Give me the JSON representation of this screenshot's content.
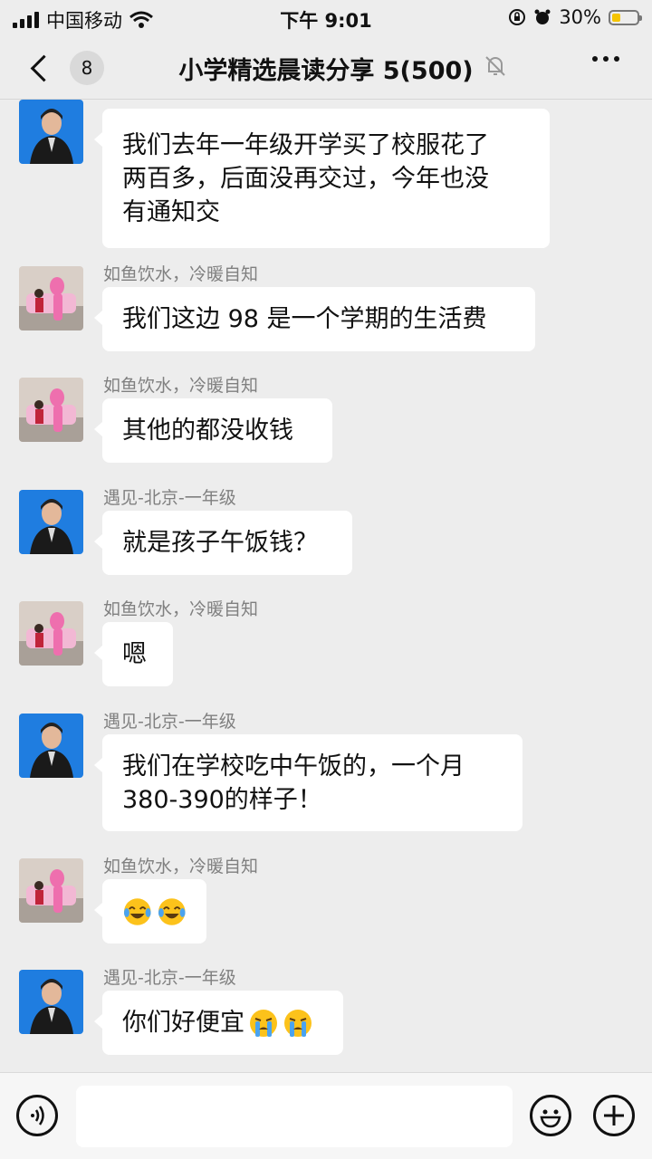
{
  "status_bar": {
    "carrier": "中国移动",
    "time": "下午 9:01",
    "battery": "30%"
  },
  "nav": {
    "back_count": "8",
    "title": "小学精选晨读分享 5(500)"
  },
  "messages": [
    {
      "sender": "遇见-北京-一年级",
      "text": [
        "我们去年一年级开学买了校服花了",
        "两百多，后面没再交过，今年也没",
        "有通知交"
      ],
      "avatar": "woman-avatar"
    },
    {
      "sender": "如鱼饮水，冷暖自知",
      "text": [
        "我们这边 98 是一个学期的生活费"
      ],
      "avatar": "pink-panther-avatar"
    },
    {
      "sender": "如鱼饮水，冷暖自知",
      "text": [
        "其他的都没收钱"
      ],
      "avatar": "pink-panther-avatar"
    },
    {
      "sender": "遇见-北京-一年级",
      "text": [
        "就是孩子午饭钱？"
      ],
      "avatar": "woman-avatar"
    },
    {
      "sender": "如鱼饮水，冷暖自知",
      "text": [
        "嗯"
      ],
      "avatar": "pink-panther-avatar"
    },
    {
      "sender": "遇见-北京-一年级",
      "text": [
        "我们在学校吃中午饭的，一个月",
        "380-390的样子！"
      ],
      "avatar": "woman-avatar"
    },
    {
      "sender": "如鱼饮水，冷暖自知",
      "text": [],
      "emojis": [
        "laugh-cry-emoji",
        "laugh-cry-emoji"
      ],
      "avatar": "pink-panther-avatar"
    },
    {
      "sender": "遇见-北京-一年级",
      "text": [
        "你们好便宜"
      ],
      "emojis": [
        "crying-emoji",
        "crying-emoji"
      ],
      "avatar": "woman-avatar"
    }
  ],
  "input": {
    "value": ""
  },
  "colors": {
    "background": "#ededed",
    "bubble": "#ffffff",
    "sender": "#808080"
  }
}
